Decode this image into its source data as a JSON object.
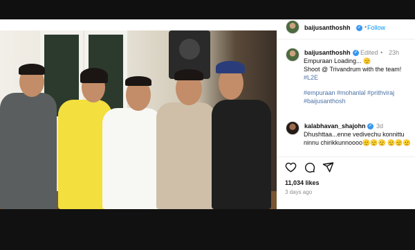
{
  "post": {
    "author": "baijusanthoshh",
    "follow_label": "Follow",
    "separator": "•",
    "caption_author": "baijusanthoshh",
    "edited_label": "Edited",
    "edited_separator": "•",
    "age": "23h",
    "caption_line1": "Empuraan Loading... 🫡",
    "caption_line2": "Shoot @ Trivandrum with the team!",
    "caption_tag": "#L2E",
    "hashtags": "#empuraan #mohanlal #prithviraj #baijusanthosh",
    "comment": {
      "author": "kalabhavan_shajohn",
      "age": "3d",
      "text": "Dhushttaa...enne vedivechu konnittu ninnu chirikkunnoooo🫡🫡🫡 🫡🫡🫡"
    },
    "likes": "11,034 likes",
    "posted": "3 days ago",
    "icons": [
      "heart-icon",
      "comment-icon",
      "share-icon"
    ],
    "colors": {
      "verified": "#3897f0",
      "follow": "#0095f6",
      "link": "#4c72a6"
    }
  }
}
